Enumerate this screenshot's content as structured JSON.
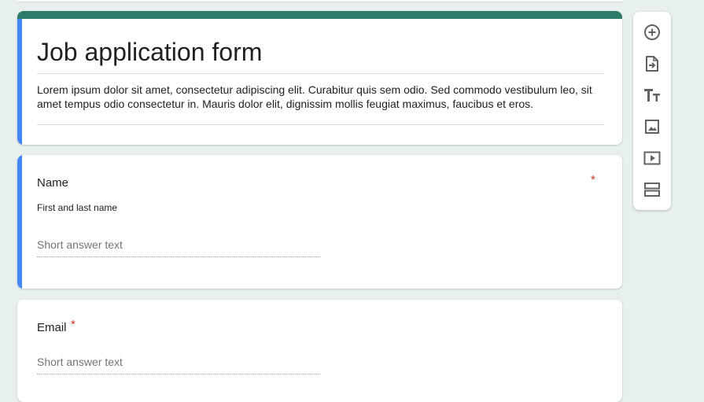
{
  "form": {
    "title": "Job application form",
    "description": "Lorem ipsum dolor sit amet, consectetur adipiscing elit. Curabitur quis sem odio. Sed commodo vestibulum leo, sit amet tempus odio consectetur in. Mauris dolor elit, dignissim mollis feugiat maximus, faucibus et eros."
  },
  "questions": [
    {
      "title": "Name",
      "description": "First and last name",
      "required_mark": "*",
      "answer_placeholder": "Short answer text"
    },
    {
      "title": "Email",
      "required_mark": "*",
      "answer_placeholder": "Short answer text"
    }
  ],
  "toolbar": {
    "items": [
      {
        "icon": "add-question-icon"
      },
      {
        "icon": "import-questions-icon"
      },
      {
        "icon": "add-title-icon"
      },
      {
        "icon": "add-image-icon"
      },
      {
        "icon": "add-video-icon"
      },
      {
        "icon": "add-section-icon"
      }
    ]
  },
  "colors": {
    "theme": "#2f7b69",
    "active_accent": "#4285f4",
    "required": "#d93025",
    "background": "#e7f0ee"
  }
}
